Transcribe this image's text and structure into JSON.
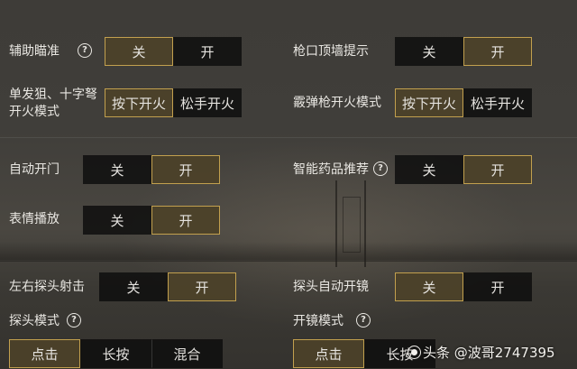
{
  "settings": {
    "aim_assist": {
      "label": "辅助瞄准",
      "options": [
        "关",
        "开"
      ],
      "selected": 0
    },
    "muzzle_wall_hint": {
      "label": "枪口顶墙提示",
      "options": [
        "关",
        "开"
      ],
      "selected": 1
    },
    "sniper_crossbow_fire": {
      "label_line1": "单发狙、十字弩",
      "label_line2": "开火模式",
      "options": [
        "按下开火",
        "松手开火"
      ],
      "selected": 0
    },
    "shotgun_fire": {
      "label": "霰弹枪开火模式",
      "options": [
        "按下开火",
        "松手开火"
      ],
      "selected": 0
    },
    "auto_open_door": {
      "label": "自动开门",
      "options": [
        "关",
        "开"
      ],
      "selected": 1
    },
    "smart_medicine": {
      "label": "智能药品推荐",
      "options": [
        "关",
        "开"
      ],
      "selected": 1
    },
    "emote_play": {
      "label": "表情播放",
      "options": [
        "关",
        "开"
      ],
      "selected": 1
    },
    "peek_fire": {
      "label": "左右探头射击",
      "options": [
        "关",
        "开"
      ],
      "selected": 1
    },
    "peek_auto_scope": {
      "label": "探头自动开镜",
      "options": [
        "关",
        "开"
      ],
      "selected": 0
    },
    "peek_mode": {
      "label": "探头模式",
      "options": [
        "点击",
        "长按",
        "混合"
      ],
      "selected": 0
    },
    "scope_mode": {
      "label": "开镜模式",
      "options": [
        "点击",
        "长按"
      ],
      "selected": 0
    }
  },
  "watermark": {
    "text": "头条 @波哥2747395"
  },
  "icons": {
    "help": "question-circle-icon",
    "watermark": "toutiao-logo-icon"
  },
  "colors": {
    "selected_border": "#c2a04e",
    "selected_fill": "#78663c",
    "button_bg": "#0c0c0c",
    "text": "#e9e7e2"
  }
}
